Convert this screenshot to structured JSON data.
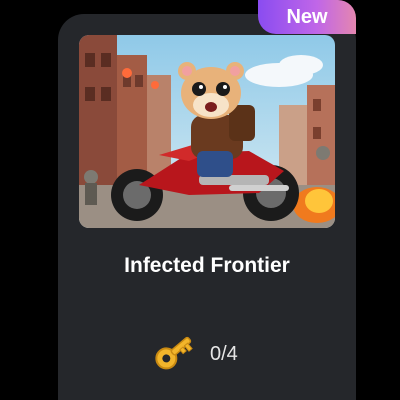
{
  "card": {
    "badge_label": "New",
    "title": "Infected Frontier",
    "key_progress": "0/4",
    "thumbnail_icon": "hamster-rider-artwork",
    "key_icon": "key-icon"
  },
  "colors": {
    "card_bg": "#25272b",
    "badge_start": "#8a4cf0",
    "badge_end": "#e486b0",
    "key_gold": "#f2b52b"
  }
}
